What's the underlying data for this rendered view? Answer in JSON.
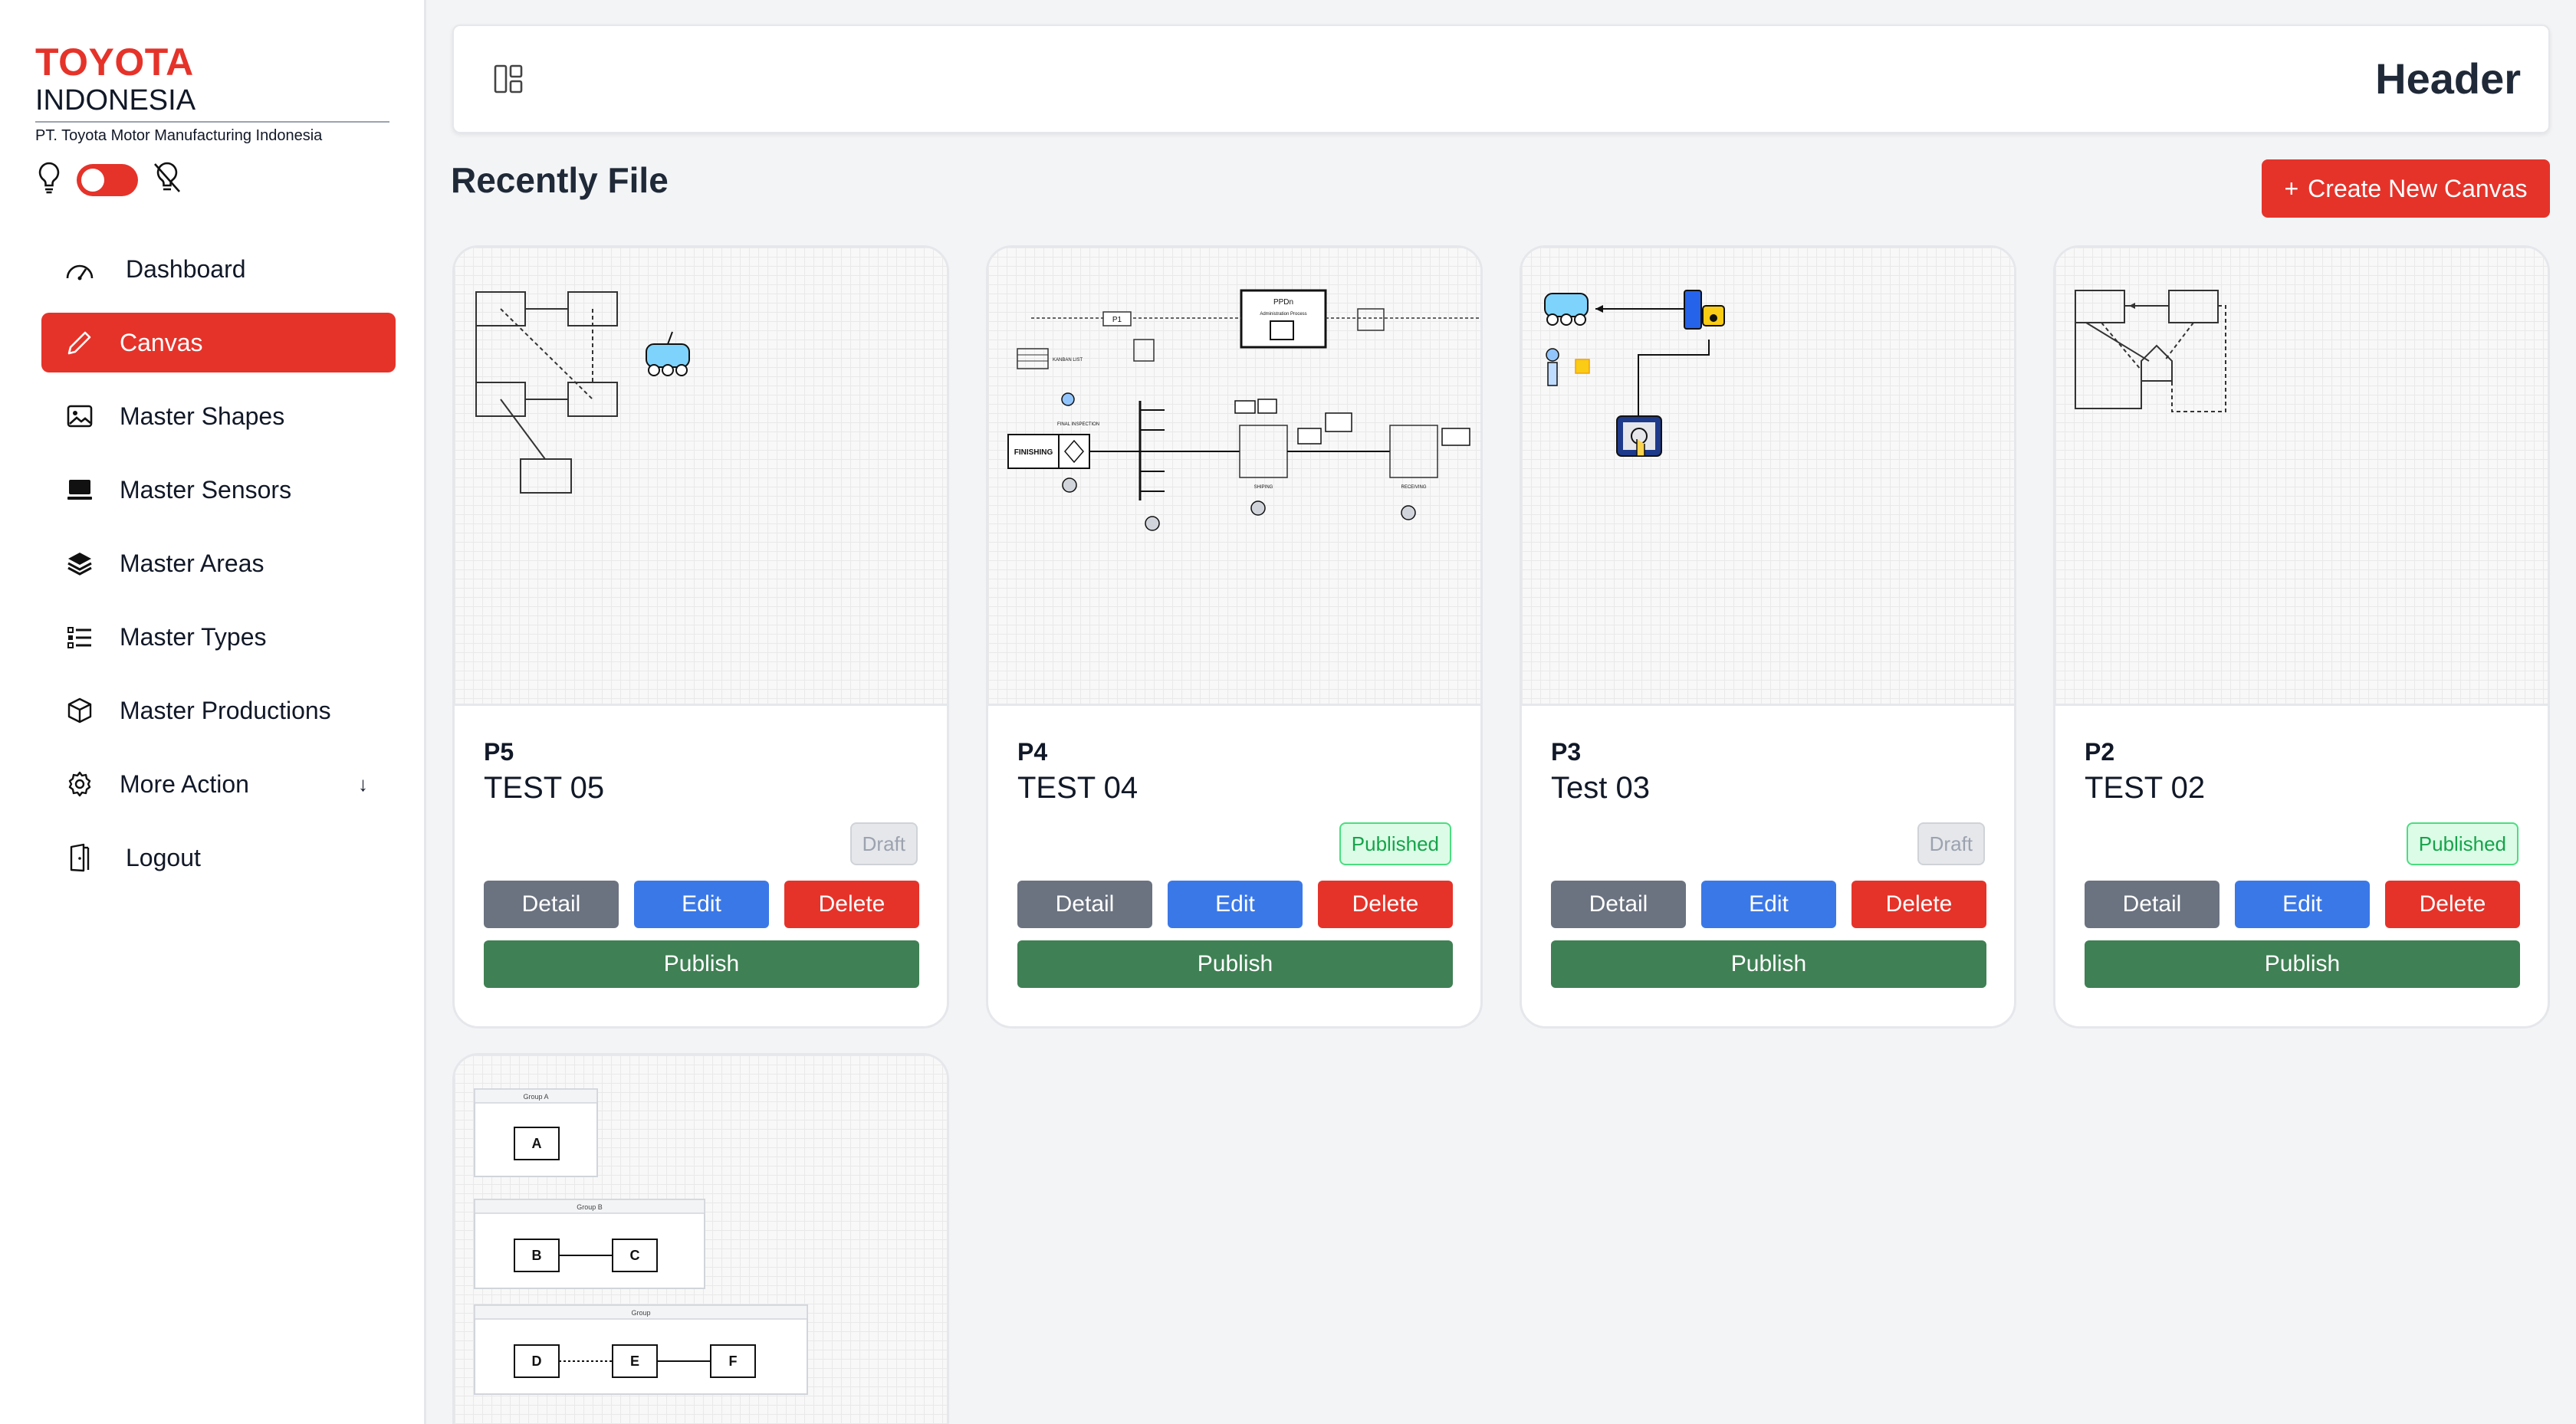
{
  "brand": {
    "name": "TOYOTA",
    "country": "INDONESIA",
    "company": "PT. Toyota Motor Manufacturing Indonesia"
  },
  "sidebar": {
    "items": [
      {
        "label": "Dashboard",
        "icon": "dashboard-gauge-icon",
        "active": false
      },
      {
        "label": "Canvas",
        "icon": "pencil-icon",
        "active": true
      },
      {
        "label": "Master Shapes",
        "icon": "image-icon",
        "active": false
      },
      {
        "label": "Master Sensors",
        "icon": "monitor-icon",
        "active": false
      },
      {
        "label": "Master Areas",
        "icon": "layers-icon",
        "active": false
      },
      {
        "label": "Master Types",
        "icon": "list-icon",
        "active": false
      },
      {
        "label": "Master Productions",
        "icon": "cube-icon",
        "active": false
      },
      {
        "label": "More Action",
        "icon": "gear-icon",
        "active": false,
        "chevron": "↓"
      },
      {
        "label": "Logout",
        "icon": "door-icon",
        "active": false
      }
    ]
  },
  "header": {
    "title": "Header"
  },
  "main": {
    "section_title": "Recently File",
    "create_button": "Create New Canvas",
    "create_button_icon": "+"
  },
  "cards": [
    {
      "code": "P5",
      "name": "TEST 05",
      "status": "Draft"
    },
    {
      "code": "P4",
      "name": "TEST 04",
      "status": "Published"
    },
    {
      "code": "P3",
      "name": "Test 03",
      "status": "Draft"
    },
    {
      "code": "P2",
      "name": "TEST 02",
      "status": "Published"
    }
  ],
  "card_actions": {
    "detail": "Detail",
    "edit": "Edit",
    "delete": "Delete",
    "publish": "Publish"
  },
  "thumbnails": {
    "p4_texts": [
      "PPDn",
      "Administration Process",
      "KANBAN LIST",
      "FINAL INSPECTION",
      "FINISHING",
      "P1",
      "SHIPING",
      "RECEIVING"
    ],
    "p1_groups": [
      "Group A",
      "Group B",
      "Group"
    ],
    "p1_nodes": [
      "A",
      "B",
      "C",
      "D",
      "E",
      "F"
    ]
  },
  "colors": {
    "accent": "#e5332a",
    "edit": "#3b78e7",
    "detail": "#6b7280",
    "publish": "#3f8054"
  }
}
